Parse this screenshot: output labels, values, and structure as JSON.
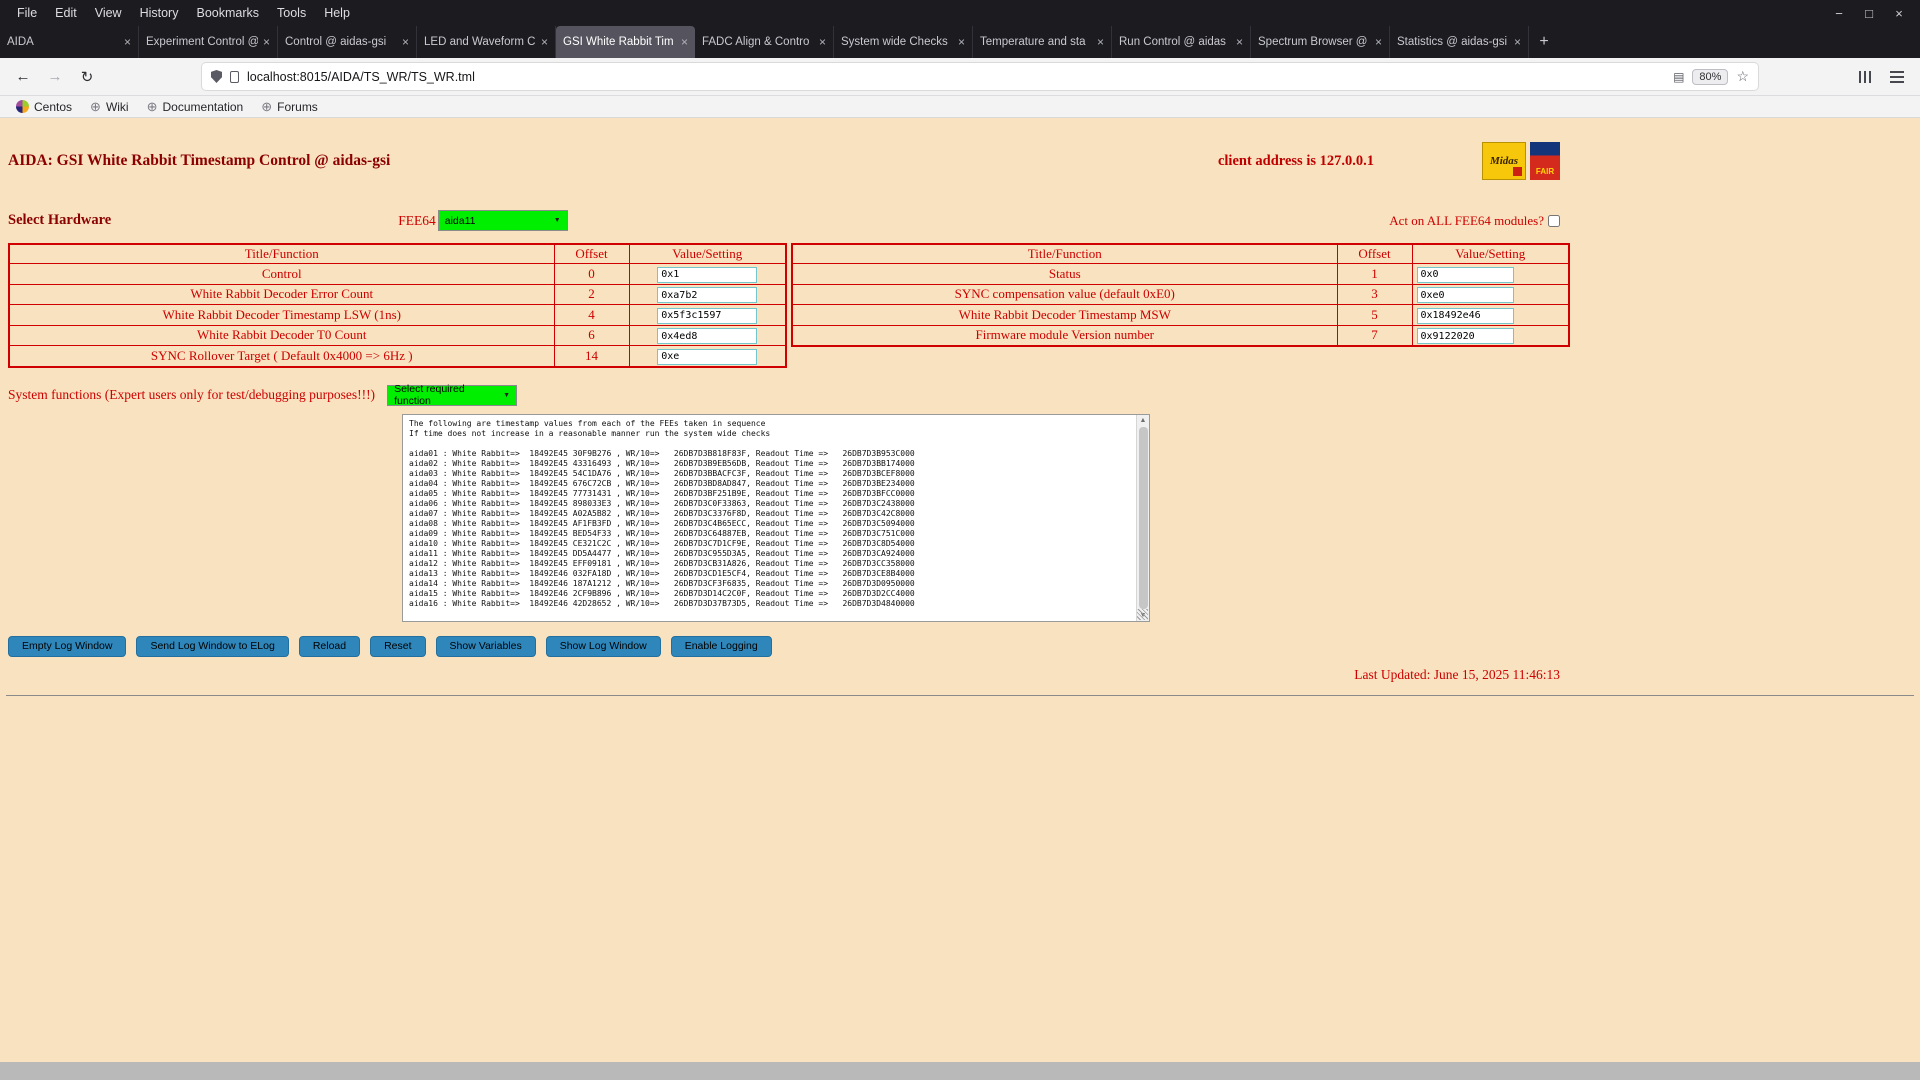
{
  "chrome": {
    "menu": [
      "File",
      "Edit",
      "View",
      "History",
      "Bookmarks",
      "Tools",
      "Help"
    ],
    "tabs": [
      {
        "label": "AIDA"
      },
      {
        "label": "Experiment Control @"
      },
      {
        "label": "Control @ aidas-gsi"
      },
      {
        "label": "LED and Waveform C"
      },
      {
        "label": "GSI White Rabbit Tim"
      },
      {
        "label": "FADC Align & Contro"
      },
      {
        "label": "System wide Checks"
      },
      {
        "label": "Temperature and sta"
      },
      {
        "label": "Run Control @ aidas"
      },
      {
        "label": "Spectrum Browser @"
      },
      {
        "label": "Statistics @ aidas-gsi"
      }
    ],
    "url": "localhost:8015/AIDA/TS_WR/TS_WR.tml",
    "zoom_level": "80%",
    "bookmarks": [
      "Centos",
      "Wiki",
      "Documentation",
      "Forums"
    ]
  },
  "icons": {
    "close": "×",
    "new_tab": "+",
    "minimize": "−",
    "maximize": "□",
    "back": "←",
    "forward": "→",
    "reload": "↻",
    "reader": "▤",
    "star": "☆",
    "globe": "⊕",
    "dropdown_arrow": "▼",
    "scroll_up": "▲",
    "scroll_down": "▼"
  },
  "page": {
    "title": "AIDA: GSI White Rabbit Timestamp Control @ aidas-gsi",
    "client_address": "client address is 127.0.0.1",
    "logos": {
      "midas": "Midas",
      "fair": "FAIR"
    },
    "select_hardware_label": "Select Hardware",
    "fee64_label": "FEE64",
    "fee64_selected": "aida11",
    "act_on_all_label": "Act on ALL FEE64 modules?",
    "left_table": {
      "headers": [
        "Title/Function",
        "Offset",
        "Value/Setting"
      ],
      "rows": [
        {
          "title": "Control",
          "offset": "0",
          "value": "0x1"
        },
        {
          "title": "White Rabbit Decoder Error Count",
          "offset": "2",
          "value": "0xa7b2"
        },
        {
          "title": "White Rabbit Decoder Timestamp LSW (1ns)",
          "offset": "4",
          "value": "0x5f3c1597"
        },
        {
          "title": "White Rabbit Decoder T0 Count",
          "offset": "6",
          "value": "0x4ed8"
        },
        {
          "title": "SYNC Rollover Target ( Default 0x4000 => 6Hz )",
          "offset": "14",
          "value": "0xe"
        }
      ]
    },
    "right_table": {
      "headers": [
        "Title/Function",
        "Offset",
        "Value/Setting"
      ],
      "rows": [
        {
          "title": "Status",
          "offset": "1",
          "value": "0x0"
        },
        {
          "title": "SYNC compensation value (default 0xE0)",
          "offset": "3",
          "value": "0xe0"
        },
        {
          "title": "White Rabbit Decoder Timestamp MSW",
          "offset": "5",
          "value": "0x18492e46"
        },
        {
          "title": "Firmware module Version number",
          "offset": "7",
          "value": "0x9122020"
        }
      ]
    },
    "system_functions_label": "System functions (Expert users only for test/debugging purposes!!!)",
    "system_functions_selected": "Select required function",
    "log_text": "The following are timestamp values from each of the FEEs taken in sequence\nIf time does not increase in a reasonable manner run the system wide checks\n\naida01 : White Rabbit=>  18492E45 30F9B276 , WR/10=>   26DB7D3B818F83F, Readout Time =>   26DB7D3B953C000\naida02 : White Rabbit=>  18492E45 43316493 , WR/10=>   26DB7D3B9EB56DB, Readout Time =>   26DB7D3BB174000\naida03 : White Rabbit=>  18492E45 54C1DA76 , WR/10=>   26DB7D3BBACFC3F, Readout Time =>   26DB7D3BCEF8000\naida04 : White Rabbit=>  18492E45 676C72CB , WR/10=>   26DB7D3BD8AD847, Readout Time =>   26DB7D3BE234000\naida05 : White Rabbit=>  18492E45 77731431 , WR/10=>   26DB7D3BF251B9E, Readout Time =>   26DB7D3BFCC0000\naida06 : White Rabbit=>  18492E45 898033E3 , WR/10=>   26DB7D3C0F33863, Readout Time =>   26DB7D3C2438000\naida07 : White Rabbit=>  18492E45 A02A5B82 , WR/10=>   26DB7D3C3376F8D, Readout Time =>   26DB7D3C42C8000\naida08 : White Rabbit=>  18492E45 AF1FB3FD , WR/10=>   26DB7D3C4B65ECC, Readout Time =>   26DB7D3C5094000\naida09 : White Rabbit=>  18492E45 BED54F33 , WR/10=>   26DB7D3C64887EB, Readout Time =>   26DB7D3C751C000\naida10 : White Rabbit=>  18492E45 CE321C2C , WR/10=>   26DB7D3C7D1CF9E, Readout Time =>   26DB7D3C8D54000\naida11 : White Rabbit=>  18492E45 DD5A4477 , WR/10=>   26DB7D3C955D3A5, Readout Time =>   26DB7D3CA924000\naida12 : White Rabbit=>  18492E45 EFF09181 , WR/10=>   26DB7D3CB31A826, Readout Time =>   26DB7D3CC358000\naida13 : White Rabbit=>  18492E46 032FA18D , WR/10=>   26DB7D3CD1E5CF4, Readout Time =>   26DB7D3CE8B4000\naida14 : White Rabbit=>  18492E46 187A1212 , WR/10=>   26DB7D3CF3F6835, Readout Time =>   26DB7D3D0950000\naida15 : White Rabbit=>  18492E46 2CF9B896 , WR/10=>   26DB7D3D14C2C0F, Readout Time =>   26DB7D3D2CC4000\naida16 : White Rabbit=>  18492E46 42D28652 , WR/10=>   26DB7D3D37B73D5, Readout Time =>   26DB7D3D4840000",
    "buttons": [
      "Empty Log Window",
      "Send Log Window to ELog",
      "Reload",
      "Reset",
      "Show Variables",
      "Show Log Window",
      "Enable Logging"
    ],
    "last_updated": "Last Updated: June 15, 2025 11:46:13"
  }
}
